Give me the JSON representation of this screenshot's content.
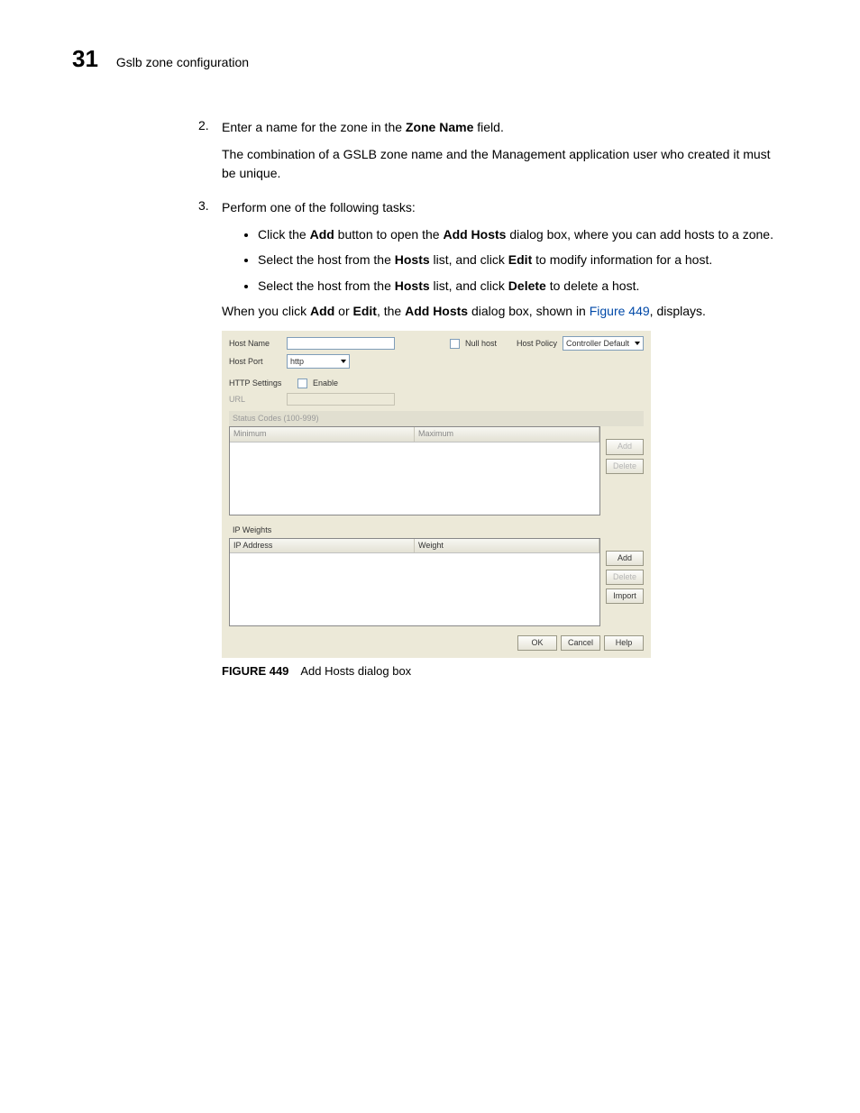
{
  "header": {
    "page_number": "31",
    "title": "Gslb zone configuration"
  },
  "steps": [
    {
      "num": "2.",
      "lines": [
        {
          "parts": [
            {
              "t": "Enter a name for the zone in the "
            },
            {
              "t": "Zone Name",
              "b": true
            },
            {
              "t": " field."
            }
          ]
        },
        {
          "parts": [
            {
              "t": "The combination of a GSLB zone name and the Management application user who created it must be unique."
            }
          ]
        }
      ]
    },
    {
      "num": "3.",
      "lines": [
        {
          "parts": [
            {
              "t": "Perform one of the following tasks:"
            }
          ]
        }
      ],
      "bullets": [
        {
          "parts": [
            {
              "t": "Click the "
            },
            {
              "t": "Add",
              "b": true
            },
            {
              "t": " button to open the "
            },
            {
              "t": "Add Hosts",
              "b": true
            },
            {
              "t": " dialog box, where you can add hosts to a zone."
            }
          ]
        },
        {
          "parts": [
            {
              "t": "Select the host from the "
            },
            {
              "t": "Hosts",
              "b": true
            },
            {
              "t": " list, and click "
            },
            {
              "t": "Edit",
              "b": true
            },
            {
              "t": " to modify information for a host."
            }
          ]
        },
        {
          "parts": [
            {
              "t": "Select the host from the "
            },
            {
              "t": "Hosts",
              "b": true
            },
            {
              "t": " list, and click "
            },
            {
              "t": "Delete",
              "b": true
            },
            {
              "t": " to delete a host."
            }
          ]
        }
      ],
      "after": {
        "parts": [
          {
            "t": "When you click "
          },
          {
            "t": "Add",
            "b": true
          },
          {
            "t": " or "
          },
          {
            "t": "Edit",
            "b": true
          },
          {
            "t": ", the "
          },
          {
            "t": "Add Hosts",
            "b": true
          },
          {
            "t": " dialog box, shown in "
          },
          {
            "t": "Figure 449",
            "link": true
          },
          {
            "t": ", displays."
          }
        ]
      }
    }
  ],
  "dialog": {
    "host_name_label": "Host Name",
    "null_host_label": "Null host",
    "host_policy_label": "Host Policy",
    "host_policy_value": "Controller Default",
    "host_port_label": "Host Port",
    "host_port_value": "http",
    "http_settings_label": "HTTP Settings",
    "enable_label": "Enable",
    "url_label": "URL",
    "status_codes_label": "Status Codes (100-999)",
    "col_min": "Minimum",
    "col_max": "Maximum",
    "ip_weights_label": "IP Weights",
    "col_ip": "IP Address",
    "col_weight": "Weight",
    "btn_add": "Add",
    "btn_delete": "Delete",
    "btn_import": "Import",
    "btn_ok": "OK",
    "btn_cancel": "Cancel",
    "btn_help": "Help"
  },
  "figure": {
    "num": "FIGURE 449",
    "caption": "Add Hosts dialog box"
  }
}
